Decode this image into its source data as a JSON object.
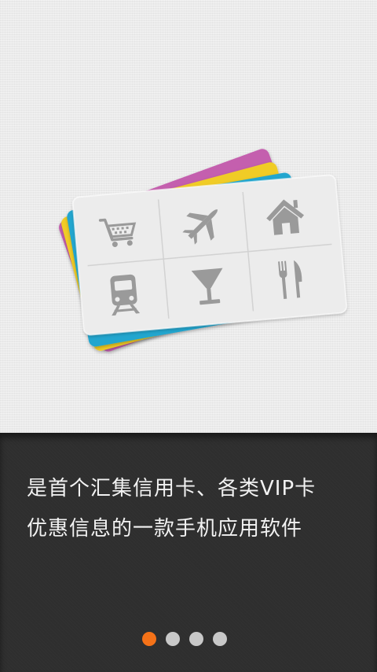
{
  "onboarding": {
    "caption_line1": "是首个汇集信用卡、各类VIP卡",
    "caption_line2": "优惠信息的一款手机应用软件"
  },
  "pager": {
    "pages": 4,
    "current_page": 1
  },
  "card_stack": {
    "card_colors": [
      "#c45fae",
      "#f0cc25",
      "#21a6cf",
      "#ececec"
    ],
    "category_icons": [
      "shopping-cart-icon",
      "airplane-icon",
      "house-icon",
      "train-icon",
      "cocktail-glass-icon",
      "fork-and-knife-icon"
    ]
  },
  "colors": {
    "active_dot": "#f57218",
    "inactive_dot": "#c8c8c8",
    "icon_gray": "#9a9a9a"
  }
}
